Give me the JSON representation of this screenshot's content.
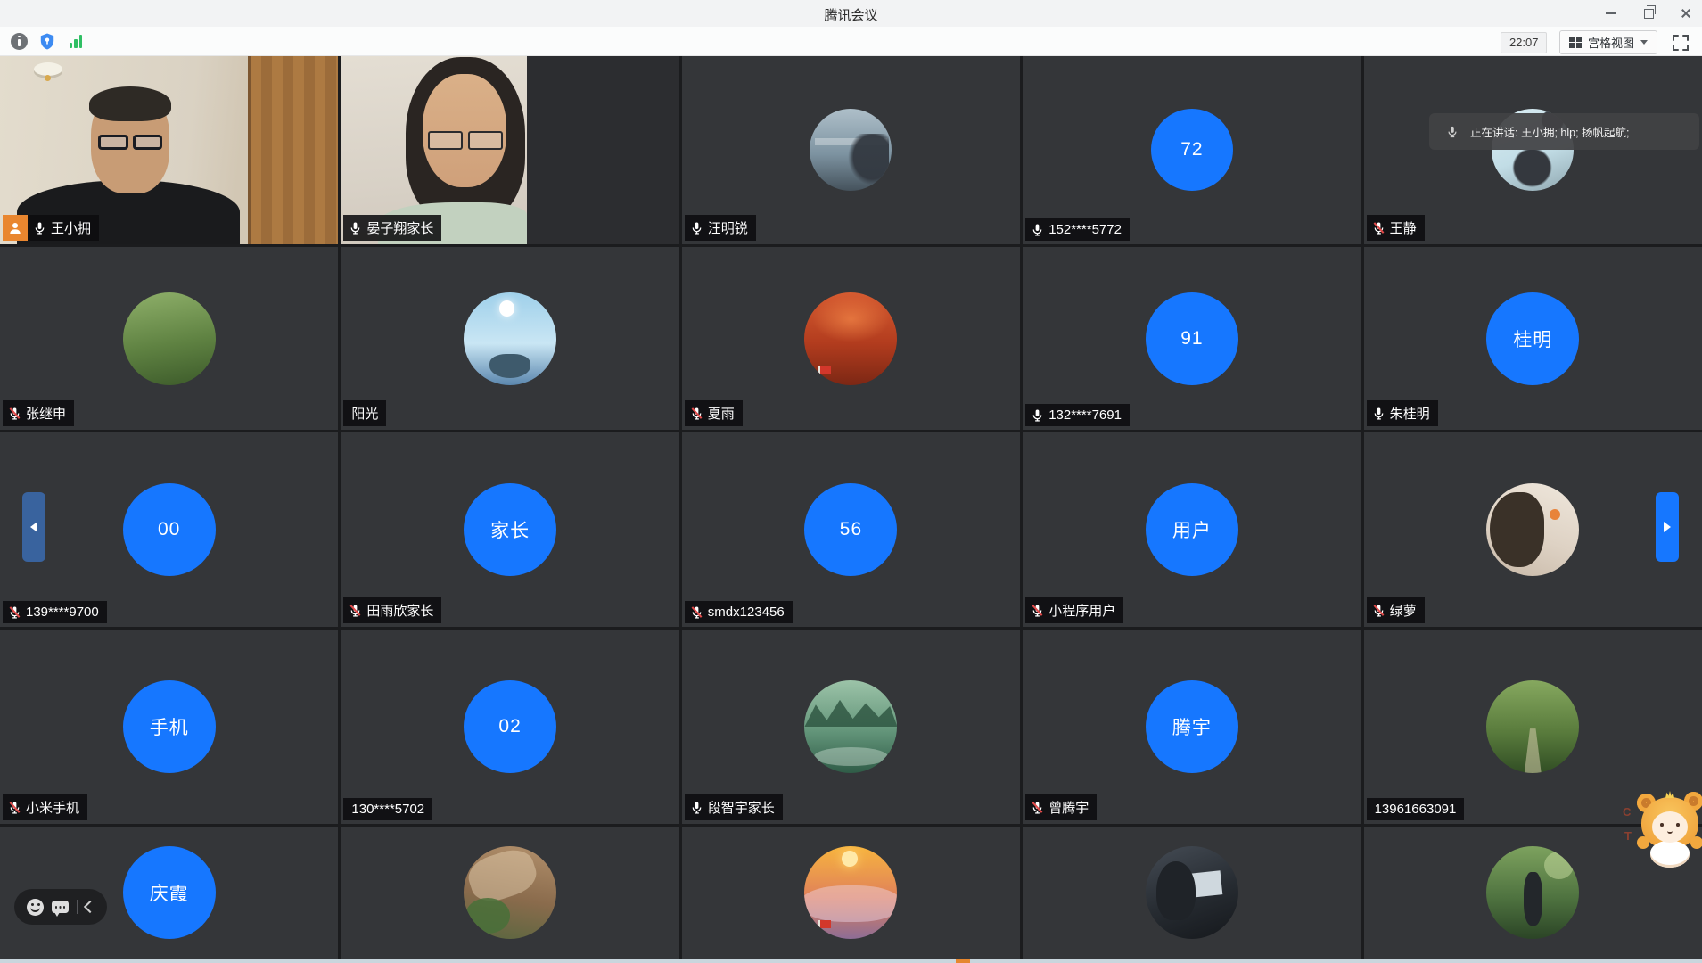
{
  "window": {
    "title": "腾讯会议"
  },
  "toolbar": {
    "time": "22:07",
    "view_label": "宫格视图"
  },
  "banner": {
    "text": "正在讲话: 王小拥; hlp; 扬帆起航;"
  },
  "colors": {
    "accent_blue": "#1677ff",
    "speaking_green": "#29a55b",
    "host_orange": "#e9862f",
    "muted_red": "#e14b4b",
    "signal_green": "#2fbf64",
    "shield_blue": "#3d8bf2"
  },
  "sticker_letters": [
    "C",
    "T"
  ],
  "photo_styles": {
    "harbor": {
      "colors": [
        "#aebfc9",
        "#7d93a1",
        "#45525c"
      ],
      "angle": 180
    },
    "cat": {
      "colors": [
        "#d9edf3",
        "#c2dde6",
        "#8fa7b0"
      ],
      "angle": 160
    },
    "park": {
      "colors": [
        "#8fb06a",
        "#5f8242",
        "#3c5a2a"
      ],
      "angle": 170
    },
    "sky": {
      "colors": [
        "#9fd0ea",
        "#c9e6f4",
        "#5b87ae"
      ],
      "angle": 180
    },
    "autumn": {
      "colors": [
        "#d65c31",
        "#b23c1e",
        "#7c2714"
      ],
      "angle": 180
    },
    "girl": {
      "colors": [
        "#efe7dc",
        "#ded2c4",
        "#c8b9a8"
      ],
      "angle": 200
    },
    "river": {
      "colors": [
        "#9cc3a8",
        "#63957a",
        "#2f5c47"
      ],
      "angle": 180
    },
    "forest": {
      "colors": [
        "#86a85f",
        "#5a7c3d",
        "#314e24"
      ],
      "angle": 180
    },
    "mountain": {
      "colors": [
        "#b2906c",
        "#8a6b4c",
        "#59663f"
      ],
      "angle": 190
    },
    "clouds": {
      "colors": [
        "#f7b43e",
        "#e0815a",
        "#8d6d96"
      ],
      "angle": 180
    },
    "laptop": {
      "colors": [
        "#454c55",
        "#262b31",
        "#15181c"
      ],
      "angle": 160
    },
    "trees": {
      "colors": [
        "#7da25e",
        "#4f7340",
        "#2b4526"
      ],
      "angle": 180
    }
  },
  "participants": [
    {
      "name": "王小拥",
      "mic": "on",
      "host": true,
      "speaking": true,
      "avatar": {
        "kind": "video",
        "variant": "man"
      }
    },
    {
      "name": "晏子翔家长",
      "mic": "on",
      "avatar": {
        "kind": "video",
        "variant": "woman"
      }
    },
    {
      "name": "汪明锐",
      "mic": "on",
      "avatar": {
        "kind": "photo",
        "variant": "harbor"
      }
    },
    {
      "name": "152****5772",
      "mic": "on",
      "avatar": {
        "kind": "initials",
        "text": "72"
      }
    },
    {
      "name": "王静",
      "mic": "muted",
      "avatar": {
        "kind": "photo",
        "variant": "cat"
      }
    },
    {
      "name": "张继申",
      "mic": "muted",
      "avatar": {
        "kind": "photo",
        "variant": "park"
      }
    },
    {
      "name": "阳光",
      "mic": "none",
      "avatar": {
        "kind": "photo",
        "variant": "sky"
      }
    },
    {
      "name": "夏雨",
      "mic": "muted",
      "avatar": {
        "kind": "photo",
        "variant": "autumn",
        "flag": true
      }
    },
    {
      "name": "132****7691",
      "mic": "on",
      "avatar": {
        "kind": "initials",
        "text": "91"
      }
    },
    {
      "name": "朱桂明",
      "mic": "on",
      "avatar": {
        "kind": "initials",
        "text": "桂明"
      }
    },
    {
      "name": "139****9700",
      "mic": "muted",
      "avatar": {
        "kind": "initials",
        "text": "00"
      }
    },
    {
      "name": "田雨欣家长",
      "mic": "muted",
      "avatar": {
        "kind": "initials",
        "text": "家长"
      }
    },
    {
      "name": "smdx123456",
      "mic": "muted",
      "avatar": {
        "kind": "initials",
        "text": "56"
      }
    },
    {
      "name": "小程序用户",
      "mic": "muted",
      "avatar": {
        "kind": "initials",
        "text": "用户"
      }
    },
    {
      "name": "绿萝",
      "mic": "muted",
      "avatar": {
        "kind": "photo",
        "variant": "girl"
      }
    },
    {
      "name": "小米手机",
      "mic": "muted",
      "avatar": {
        "kind": "initials",
        "text": "手机"
      }
    },
    {
      "name": "130****5702",
      "mic": "none",
      "avatar": {
        "kind": "initials",
        "text": "02"
      }
    },
    {
      "name": "段智宇家长",
      "mic": "on",
      "avatar": {
        "kind": "photo",
        "variant": "river"
      }
    },
    {
      "name": "曾腾宇",
      "mic": "muted",
      "avatar": {
        "kind": "initials",
        "text": "腾宇"
      }
    },
    {
      "name": "13961663091",
      "mic": "none",
      "avatar": {
        "kind": "photo",
        "variant": "forest"
      }
    },
    {
      "label_visible": false,
      "avatar": {
        "kind": "initials",
        "text": "庆霞"
      }
    },
    {
      "label_visible": false,
      "avatar": {
        "kind": "photo",
        "variant": "mountain"
      }
    },
    {
      "label_visible": false,
      "avatar": {
        "kind": "photo",
        "variant": "clouds",
        "flag": true
      }
    },
    {
      "label_visible": false,
      "avatar": {
        "kind": "photo",
        "variant": "laptop"
      }
    },
    {
      "label_visible": false,
      "avatar": {
        "kind": "photo",
        "variant": "trees"
      }
    }
  ]
}
